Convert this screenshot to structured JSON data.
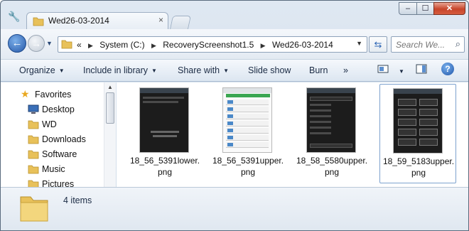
{
  "window": {
    "title_tab": "Wed26-03-2014"
  },
  "titlebar_buttons": {
    "minimize": "–",
    "maximize": "☐",
    "close": "✕"
  },
  "navigation": {
    "back_label": "←",
    "forward_label": "→",
    "breadcrumb": [
      "System (C:)",
      "RecoveryScreenshot1.5",
      "Wed26-03-2014"
    ],
    "breadcrumb_overflow": "«",
    "search_placeholder": "Search We..."
  },
  "toolbar": {
    "organize": "Organize",
    "include_in_library": "Include in library",
    "share_with": "Share with",
    "slide_show": "Slide show",
    "burn": "Burn",
    "more": "»",
    "help": "?"
  },
  "sidebar": {
    "favorites": "Favorites",
    "items": [
      {
        "label": "Desktop",
        "icon": "desktop-icon"
      },
      {
        "label": "WD",
        "icon": "folder-icon"
      },
      {
        "label": "Downloads",
        "icon": "folder-icon"
      },
      {
        "label": "Software",
        "icon": "folder-icon"
      },
      {
        "label": "Music",
        "icon": "folder-icon"
      },
      {
        "label": "Pictures",
        "icon": "folder-icon"
      }
    ]
  },
  "files": [
    {
      "line1": "18_56_5391lower.",
      "line2": "png",
      "style": "dark-text"
    },
    {
      "line1": "18_56_5391upper.",
      "line2": "png",
      "style": "light-list"
    },
    {
      "line1": "18_58_5580upper.",
      "line2": "png",
      "style": "dark-list"
    },
    {
      "line1": "18_59_5183upper.",
      "line2": "png",
      "style": "dark-grid",
      "selected": true
    }
  ],
  "details": {
    "count": "4 items"
  },
  "colors": {
    "accent": "#2658a8",
    "folder": "#e8c15a",
    "selection": "#7da2ce"
  }
}
